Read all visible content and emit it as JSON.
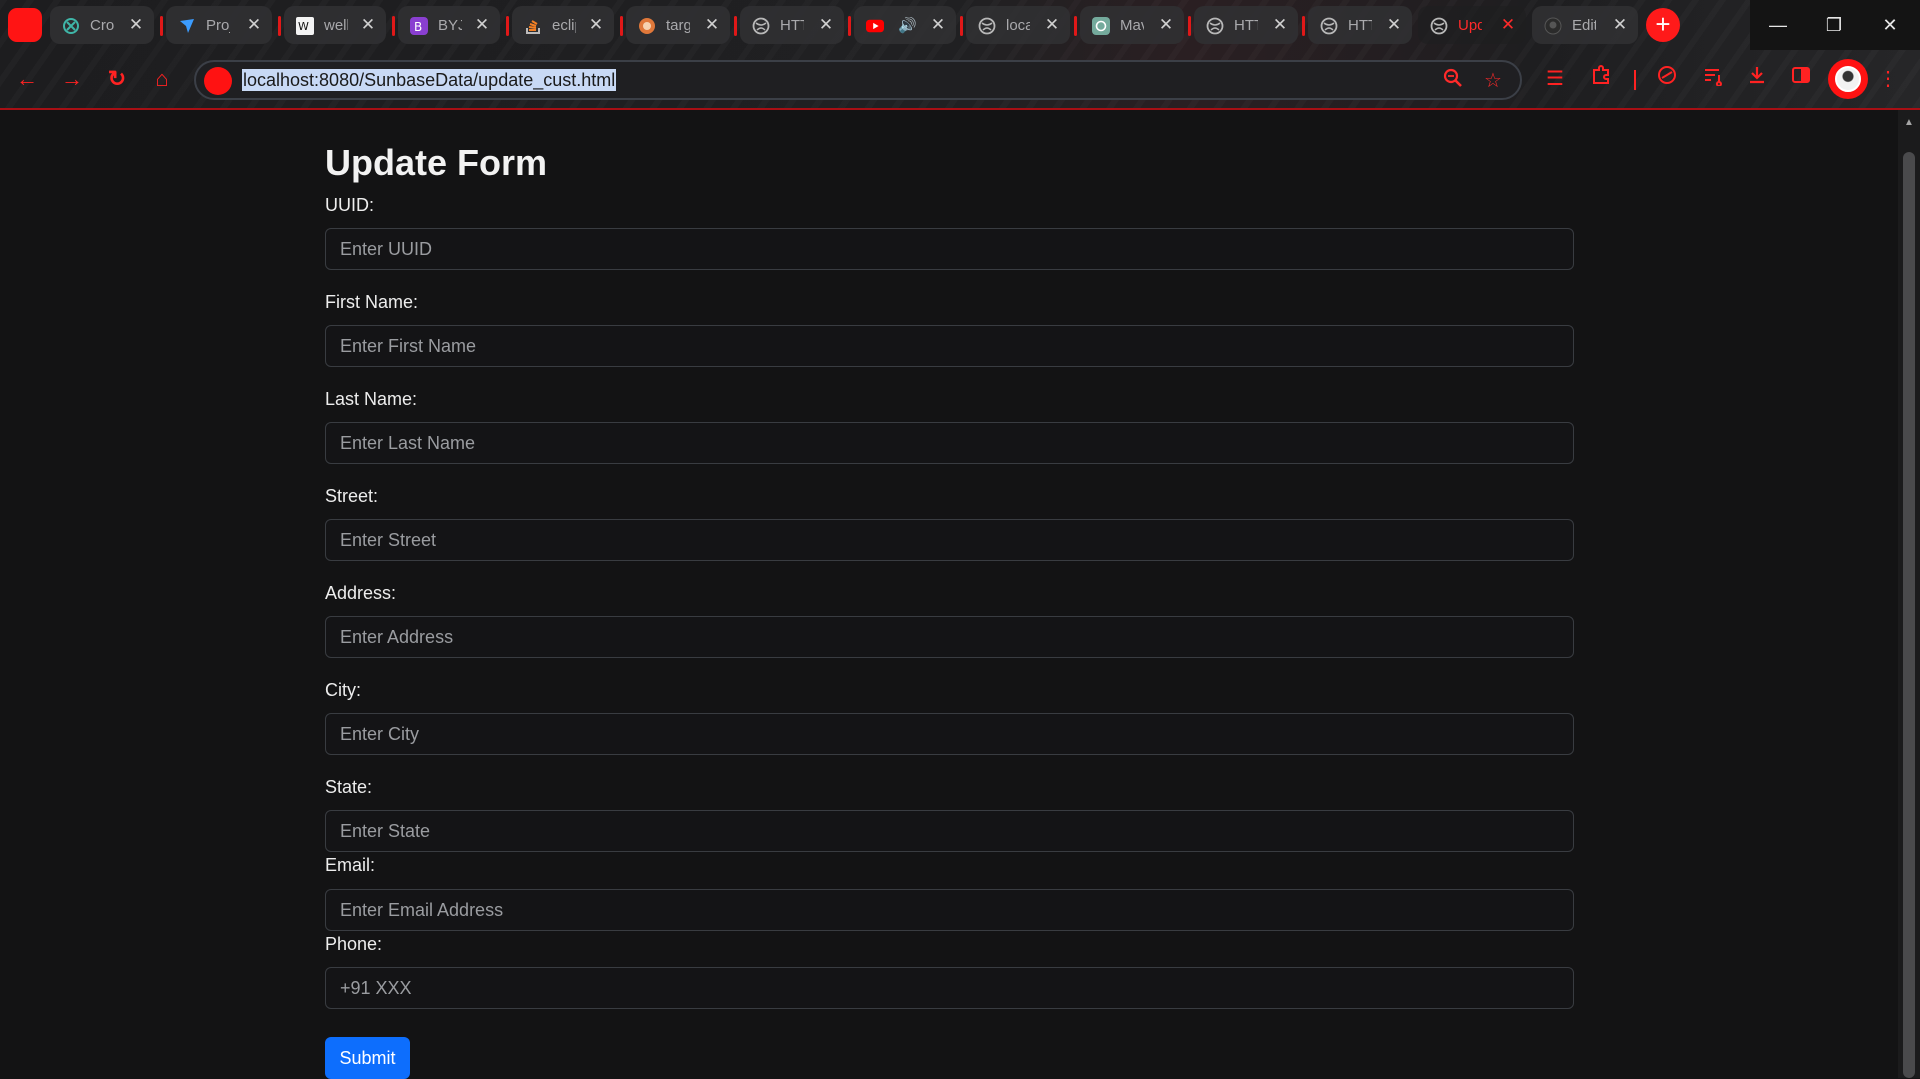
{
  "browser": {
    "tabs": [
      {
        "title": "Cro",
        "icon": "crossref-icon"
      },
      {
        "title": "Proj",
        "icon": "bird-icon"
      },
      {
        "title": "well",
        "icon": "w-icon"
      },
      {
        "title": "BYJU",
        "icon": "byjus-icon"
      },
      {
        "title": "eclip",
        "icon": "stackoverflow-icon"
      },
      {
        "title": "targ",
        "icon": "orange-circle-icon"
      },
      {
        "title": "HTT",
        "icon": "globe-icon"
      },
      {
        "title": "",
        "icon": "youtube-icon",
        "audio": true
      },
      {
        "title": "loca",
        "icon": "globe-icon"
      },
      {
        "title": "Mav",
        "icon": "chatgpt-icon"
      },
      {
        "title": "HTT",
        "icon": "globe-icon"
      },
      {
        "title": "HTT",
        "icon": "globe-icon"
      },
      {
        "title": "Upd",
        "icon": "globe-icon",
        "active": true
      },
      {
        "title": "Edit",
        "icon": "github-icon"
      }
    ],
    "url": "localhost:8080/SunbaseData/update_cust.html",
    "accent_color": "#ff1a1a"
  },
  "form": {
    "title": "Update Form",
    "fields": [
      {
        "label": "UUID:",
        "placeholder": "Enter UUID"
      },
      {
        "label": "First Name:",
        "placeholder": "Enter First Name"
      },
      {
        "label": "Last Name:",
        "placeholder": "Enter Last Name"
      },
      {
        "label": "Street:",
        "placeholder": "Enter Street"
      },
      {
        "label": "Address:",
        "placeholder": "Enter Address"
      },
      {
        "label": "City:",
        "placeholder": "Enter City"
      },
      {
        "label": "State:",
        "placeholder": "Enter State"
      },
      {
        "label": "Email:",
        "placeholder": "Enter Email Address"
      },
      {
        "label": "Phone:",
        "placeholder": "+91 XXX"
      }
    ],
    "submit_label": "Submit",
    "submit_color": "#0d6efd"
  }
}
